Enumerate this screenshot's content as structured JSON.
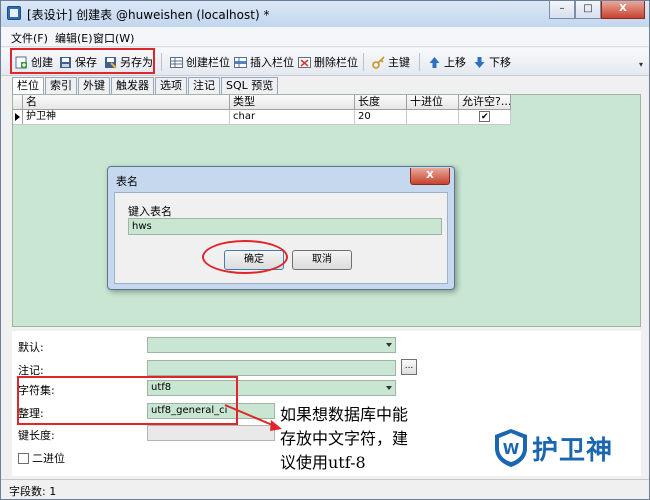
{
  "window": {
    "title": "[表设计] 创建表 @huweishen (localhost) *",
    "controls": [
      "–",
      "□",
      "X"
    ]
  },
  "menubar": {
    "items": [
      "文件(F)",
      "编辑(E)",
      "窗口(W)"
    ]
  },
  "toolbar": {
    "create": "创建",
    "save": "保存",
    "save_as": "另存为",
    "create_field": "创建栏位",
    "insert_field": "插入栏位",
    "delete_field": "删除栏位",
    "primary_key": "主键",
    "move_up": "上移",
    "move_down": "下移",
    "overflow": "▾"
  },
  "tabs": [
    "栏位",
    "索引",
    "外键",
    "触发器",
    "选项",
    "注记",
    "SQL 预览"
  ],
  "grid": {
    "columns": [
      "名",
      "类型",
      "长度",
      "十进位",
      "允许空?..."
    ],
    "rows": [
      {
        "name": "护卫神",
        "type": "char",
        "length": "20",
        "decimals": "",
        "allow_null": true
      }
    ]
  },
  "dialog": {
    "title": "表名",
    "close": "X",
    "label": "键入表名",
    "value": "hws",
    "ok": "确定",
    "cancel": "取消"
  },
  "properties": {
    "default_label": "默认:",
    "comment_label": "注记:",
    "comment_button": "...",
    "charset_label": "字符集:",
    "charset_value": "utf8",
    "collation_label": "整理:",
    "collation_value": "utf8_general_ci",
    "key_length_label": "键长度:",
    "binary_label": "二进位",
    "binary_checked": false
  },
  "annotation": {
    "lines": [
      "如果想数据库中能",
      "存放中文字符，建",
      "议使用utf-8"
    ]
  },
  "watermark": {
    "text": "护卫神",
    "logo_letter": "W"
  },
  "statusbar": {
    "text": "字段数: 1"
  },
  "colors": {
    "highlight_red": "#e0262a",
    "field_green": "#c8e6d2",
    "brand_blue": "#1a66b0"
  }
}
